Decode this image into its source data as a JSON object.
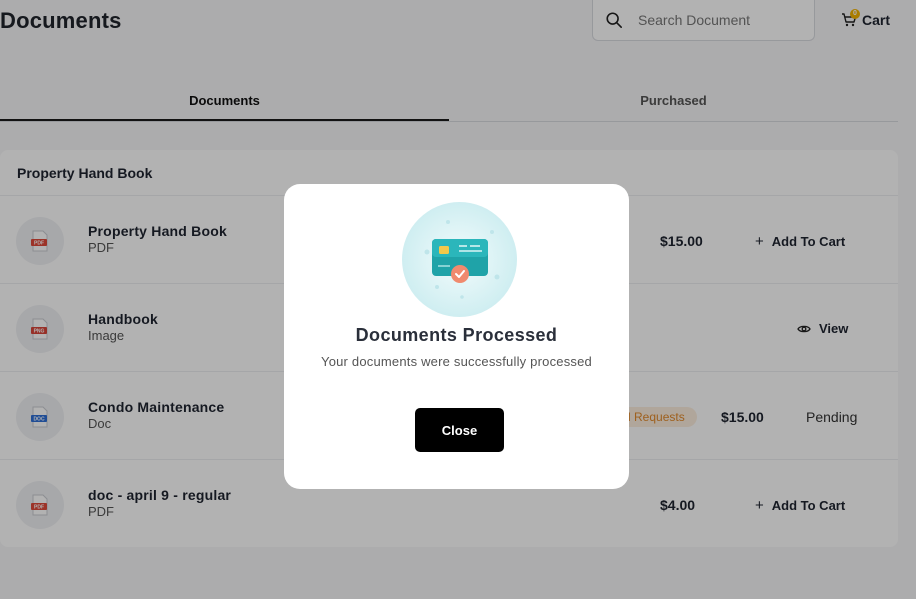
{
  "header": {
    "title": "Documents",
    "search_placeholder": "Search Document",
    "cart_label": "Cart",
    "cart_count": "0"
  },
  "tabs": [
    {
      "label": "Documents",
      "active": true
    },
    {
      "label": "Purchased",
      "active": false
    }
  ],
  "section": {
    "title": "Property Hand Book",
    "rows": [
      {
        "name": "Property Hand Book",
        "type": "PDF",
        "badge": "PDF",
        "price": "$15.00",
        "action": "Add To Cart",
        "action_icon": "plus-icon"
      },
      {
        "name": "Handbook",
        "type": "Image",
        "badge": "PNG",
        "action": "View",
        "action_icon": "eye-icon"
      },
      {
        "name": "Condo Maintenance",
        "type": "Doc",
        "badge": "DOC",
        "pill": "d Requests",
        "price": "$15.00",
        "status": "Pending"
      },
      {
        "name": "doc - april 9 - regular",
        "type": "PDF",
        "badge": "PDF",
        "price": "$4.00",
        "action": "Add To Cart",
        "action_icon": "plus-icon"
      }
    ]
  },
  "modal": {
    "title": "Documents Processed",
    "subtitle": "Your documents were successfully processed",
    "close_label": "Close"
  },
  "colors": {
    "pdf": "#e04a3a",
    "png": "#d8453a",
    "doc": "#2f6fd6",
    "pill_bg": "#fdeede",
    "pill_text": "#e28a2b",
    "badge": "#f4b400"
  }
}
